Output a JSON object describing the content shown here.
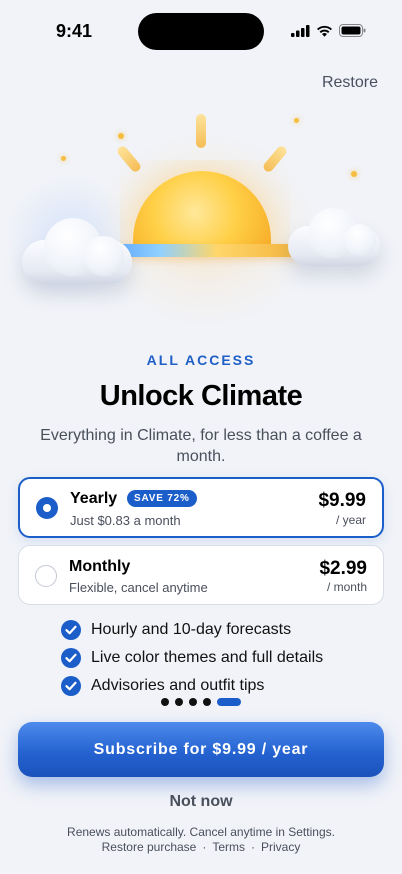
{
  "status_bar": {
    "time": "9:41",
    "icons": [
      "cellular-signal-icon",
      "wifi-icon",
      "battery-icon"
    ]
  },
  "header": {
    "restore_label": "Restore"
  },
  "hero": {
    "illustration": "sun-rising-between-clouds",
    "colors": {
      "sun": "#ffcf45",
      "horizon_left": "#5fa8ff",
      "horizon_right": "#f3b33a"
    }
  },
  "content": {
    "eyebrow": "ALL ACCESS",
    "title": "Unlock Climate",
    "subtitle": "Everything in Climate, for less than a coffee a month."
  },
  "plans": [
    {
      "name": "Yearly",
      "badge": "SAVE 72%",
      "description": "Just $0.83 a month",
      "price": "$9.99",
      "period": "/ year",
      "selected": true
    },
    {
      "name": "Monthly",
      "description": "Flexible, cancel anytime",
      "price": "$2.99",
      "period": "/ month",
      "selected": false
    }
  ],
  "features": [
    {
      "text": "Hourly and 10-day forecasts",
      "icon": "checkmark-circle-icon"
    },
    {
      "text": "Live color themes and full details",
      "icon": "checkmark-circle-icon"
    },
    {
      "text": "Advisories and outfit tips",
      "icon": "checkmark-circle-icon"
    }
  ],
  "pagination": {
    "count": 5,
    "active_index": 4
  },
  "cta": {
    "label": "Subscribe for $9.99 / year"
  },
  "secondary": {
    "not_now_label": "Not now"
  },
  "footer": {
    "fineprint": "Renews automatically. Cancel anytime in Settings.",
    "links": [
      "Restore purchase",
      "Terms",
      "Privacy"
    ],
    "separator": "·"
  },
  "colors": {
    "accent": "#1c5ec9",
    "background": "#f1f3f8",
    "secondary_text": "#4a4f5c"
  }
}
